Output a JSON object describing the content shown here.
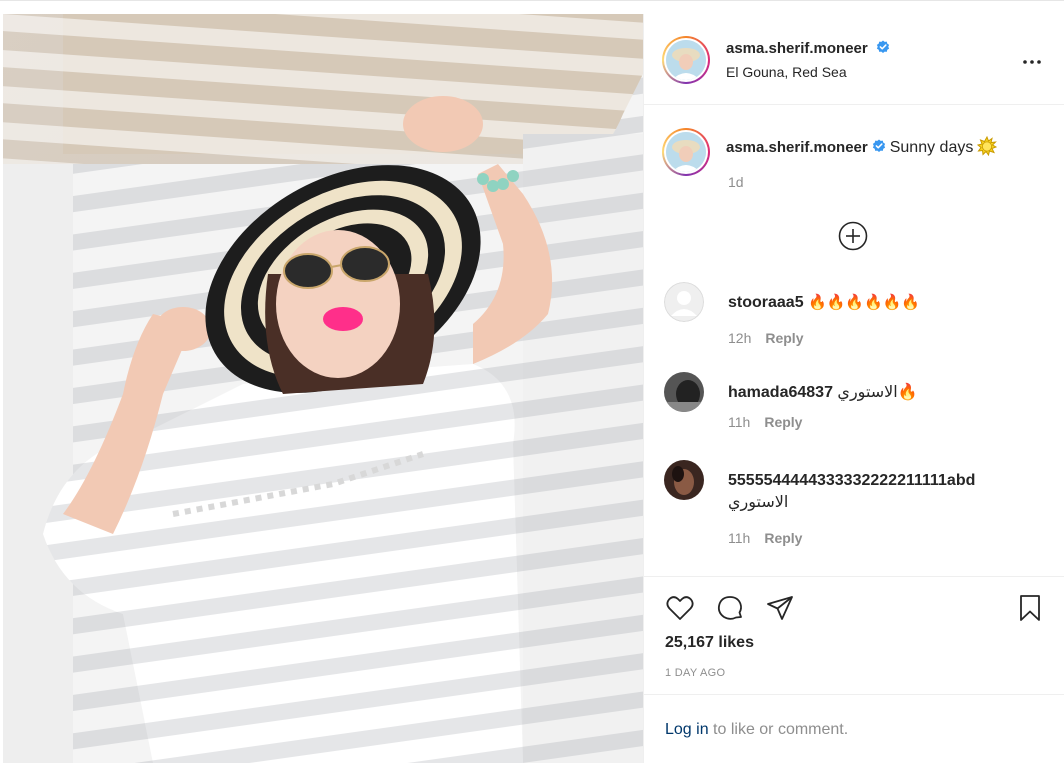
{
  "post": {
    "username": "asma.sherif.moneer",
    "location": "El Gouna, Red Sea",
    "caption": "Sunny days",
    "caption_time": "1d",
    "likes": "25,167 likes",
    "time_ago": "1 DAY AGO"
  },
  "comments": [
    {
      "username": "stooraaa5",
      "text": "🔥🔥🔥🔥🔥🔥",
      "time": "12h",
      "reply_label": "Reply"
    },
    {
      "username": "hamada64837",
      "text": "الاستوري🔥",
      "time": "11h",
      "reply_label": "Reply"
    },
    {
      "username": "5555544444333332222211111abd",
      "text": "الاستوري",
      "time": "11h",
      "reply_label": "Reply"
    }
  ],
  "login": {
    "link_text": "Log in",
    "rest_text": " to like or comment."
  },
  "icons": {
    "verified": "verified-badge-icon",
    "more": "more-options-icon",
    "load_more": "plus-circle-icon",
    "like": "heart-icon",
    "comment": "comment-icon",
    "share": "paper-plane-icon",
    "save": "bookmark-icon"
  },
  "colors": {
    "verified_blue": "#3897f0",
    "text": "#262626",
    "muted": "#8e8e8e",
    "link": "#00376b"
  }
}
